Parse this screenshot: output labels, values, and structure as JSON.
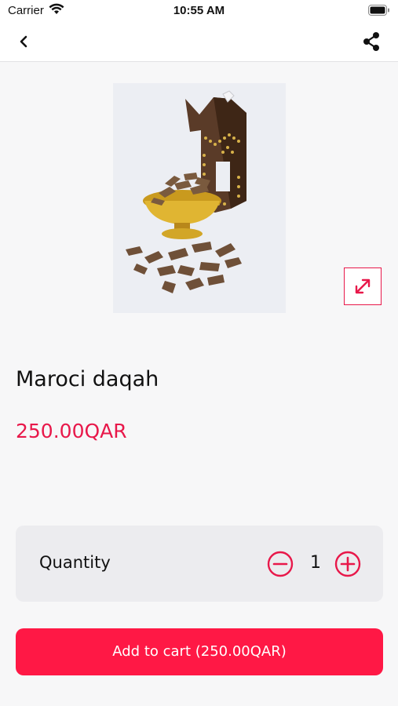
{
  "status_bar": {
    "carrier": "Carrier",
    "time": "10:55 AM"
  },
  "nav": {
    "back_icon": "chevron-left-icon",
    "share_icon": "share-icon"
  },
  "product": {
    "name": "Maroci daqah",
    "price": "250.00QAR",
    "image_icon": "product-photo",
    "expand_icon": "expand-icon"
  },
  "quantity": {
    "label": "Quantity",
    "value": "1"
  },
  "cart": {
    "add_label": "Add to cart (250.00QAR)"
  },
  "colors": {
    "accent": "#e8184a",
    "button": "#ff1845",
    "background": "#f7f7f8",
    "card": "#ececef"
  }
}
